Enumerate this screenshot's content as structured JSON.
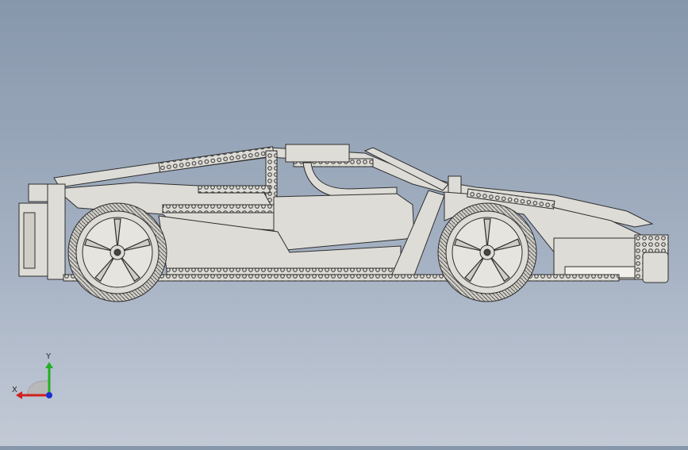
{
  "view": {
    "background_top": "#8797ab",
    "background_bottom": "#c3cad6",
    "model_fill": "#dedcd6",
    "model_edge": "#2e2e2e",
    "model_shadow": "#a9a79f"
  },
  "model": {
    "icon": "lego-technic-supercar-side-view"
  },
  "triad": {
    "x_label": "X",
    "y_label": "Y",
    "x_color": "#d12020",
    "y_color": "#22b022",
    "z_color": "#1d2fcf"
  }
}
